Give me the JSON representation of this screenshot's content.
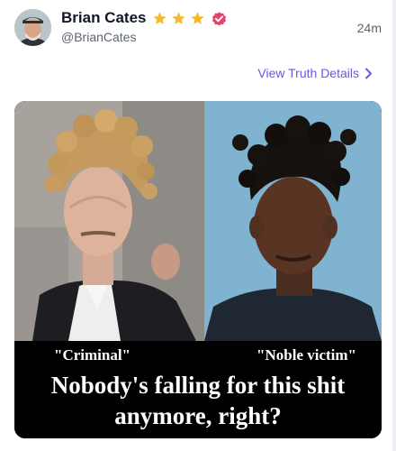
{
  "post": {
    "author": {
      "display_name": "Brian Cates",
      "handle": "@BrianCates",
      "star_count": 3,
      "badge": "verified-badge-icon"
    },
    "timestamp": "24m",
    "view_details_label": "View Truth Details",
    "image": {
      "label_left": "\"Criminal\"",
      "label_right": "\"Noble victim\"",
      "caption_line1": "Nobody's falling for this shit",
      "caption_line2": "anymore, right?"
    }
  },
  "colors": {
    "accent": "#7153e6",
    "badge": "#e8406d",
    "star": "#f5b82e",
    "muted_text": "#5b6472"
  }
}
